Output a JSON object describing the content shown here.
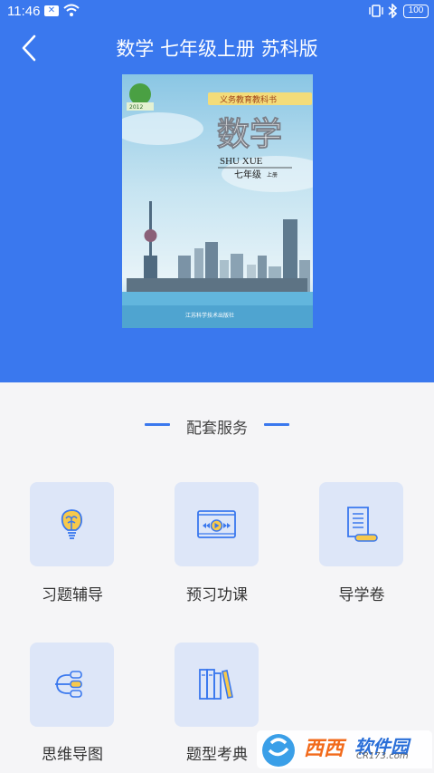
{
  "status_bar": {
    "time": "11:46",
    "mail_badge": "✕",
    "battery": "100"
  },
  "header": {
    "title": "数学 七年级上册 苏科版",
    "background_color": "#3a78ee"
  },
  "cover": {
    "series_label": "义务教育教科书",
    "subject": "数学",
    "pinyin": "SHU XUE",
    "grade": "七年级",
    "volume": "上册",
    "publisher": "江苏科学技术出版社",
    "logo_label": "2012"
  },
  "services": {
    "section_title": "配套服务",
    "items": [
      {
        "label": "习题辅导",
        "icon": "lightbulb-brain-icon"
      },
      {
        "label": "预习功课",
        "icon": "video-player-icon"
      },
      {
        "label": "导学卷",
        "icon": "document-scroll-icon"
      },
      {
        "label": "思维导图",
        "icon": "mind-map-icon"
      },
      {
        "label": "题型考典",
        "icon": "books-icon"
      }
    ]
  },
  "watermark": {
    "brand_a": "西西",
    "brand_b": "软件园",
    "url": "CR173.com"
  }
}
